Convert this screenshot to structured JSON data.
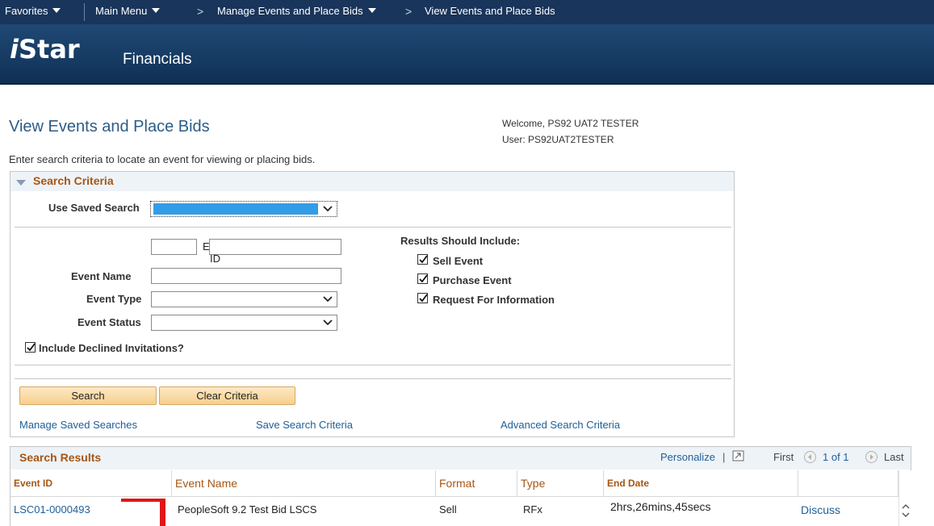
{
  "topnav": {
    "favorites": "Favorites",
    "main_menu": "Main Menu",
    "chevron": ">",
    "breadcrumb1": "Manage Events and Place Bids",
    "breadcrumb2": "View Events and Place Bids"
  },
  "brand": {
    "logo_i": "i",
    "logo_star": "Star",
    "subtitle": "Financials"
  },
  "page": {
    "title": "View Events and Place Bids",
    "welcome": "Welcome, PS92 UAT2 TESTER",
    "user": "User: PS92UAT2TESTER",
    "instructions": "Enter search criteria to locate an event for viewing or placing bids."
  },
  "criteria": {
    "title": "Search Criteria",
    "use_saved_search_label": "Use Saved Search",
    "event_label": "Event",
    "id_label": "ID",
    "event_name_label": "Event Name",
    "event_type_label": "Event Type",
    "event_status_label": "Event Status",
    "include_declined_label": "Include Declined Invitations?",
    "include_declined_checked": true,
    "results_should_include": "Results Should Include:",
    "sell_event": "Sell Event",
    "purchase_event": "Purchase Event",
    "request_for_information": "Request For Information",
    "search_button": "Search",
    "clear_button": "Clear Criteria",
    "manage_saved_searches": "Manage Saved Searches",
    "save_search_criteria": "Save Search Criteria",
    "advanced_search_criteria": "Advanced Search Criteria"
  },
  "results": {
    "title": "Search Results",
    "personalize": "Personalize",
    "pipe": "|",
    "first": "First",
    "count": "1 of 1",
    "last": "Last",
    "columns": [
      "Event ID",
      "Event Name",
      "Format",
      "Type",
      "End Date"
    ],
    "rows": [
      {
        "event_id": "LSC01-0000493",
        "event_name": "PeopleSoft 9.2 Test Bid LSCS",
        "format": "Sell",
        "type": "RFx",
        "end_date": "2hrs,26mins,45secs",
        "action": "Discuss"
      }
    ]
  },
  "colors": {
    "nav": "#19355b",
    "link": "#1e5e98",
    "section_title": "#a75512",
    "highlight": "#e01616"
  },
  "icons": [
    "dropdown-arrow-icon",
    "checkbox-checked-icon",
    "collapse-triangle-icon",
    "personalize-grid-icon",
    "previous-arrow-icon",
    "next-arrow-icon",
    "scroll-arrows-icon"
  ]
}
